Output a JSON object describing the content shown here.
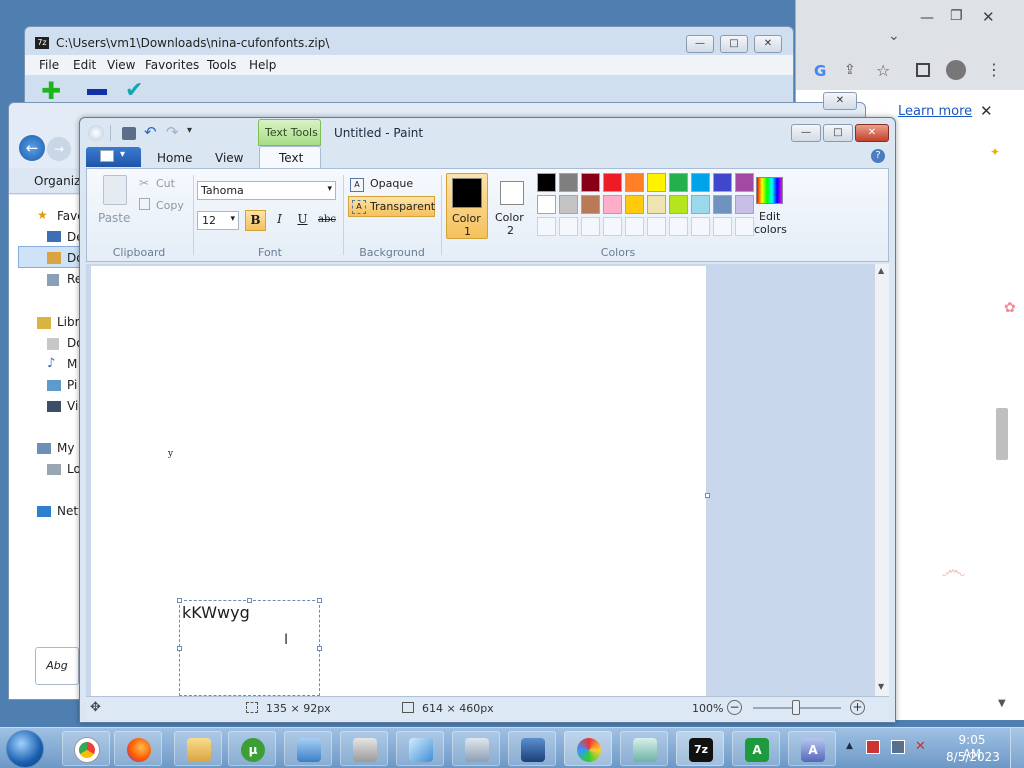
{
  "chrome": {
    "learn_more": "Learn more",
    "close_glyph": "✕"
  },
  "sevenzip": {
    "title": "C:\\Users\\vm1\\Downloads\\nina-cufonfonts.zip\\",
    "menu": [
      "File",
      "Edit",
      "View",
      "Favorites",
      "Tools",
      "Help"
    ]
  },
  "explorer": {
    "organize": "Organize",
    "nav": [
      "Favo",
      "De",
      "Do",
      "Re",
      "Libr",
      "Do",
      "M",
      "Pi",
      "Vi",
      "My",
      "Lo",
      "Netw"
    ],
    "preview_label": "Abg"
  },
  "paint": {
    "title": "Untitled - Paint",
    "context_tab": "Text Tools",
    "tabs": [
      "Home",
      "View",
      "Text"
    ],
    "clipboard": {
      "paste": "Paste",
      "cut": "Cut",
      "copy": "Copy",
      "label": "Clipboard"
    },
    "font": {
      "family": "Tahoma",
      "size": "12",
      "bold": "B",
      "italic": "I",
      "underline": "U",
      "strike": "abc",
      "label": "Font"
    },
    "background": {
      "opaque": "Opaque",
      "transparent": "Transparent",
      "label": "Background"
    },
    "colors": {
      "color1": "Color",
      "color1_num": "1",
      "color2": "Color",
      "color2_num": "2",
      "edit": "Edit",
      "edit2": "colors",
      "label": "Colors",
      "row1": [
        "#000000",
        "#7f7f7f",
        "#880015",
        "#ed1c24",
        "#ff7f27",
        "#fff200",
        "#22b14c",
        "#00a2e8",
        "#3f48cc",
        "#a349a4"
      ],
      "row2": [
        "#ffffff",
        "#c3c3c3",
        "#b97a57",
        "#ffaec9",
        "#ffc90e",
        "#efe4b0",
        "#b5e61d",
        "#99d9ea",
        "#7092be",
        "#c8bfe7"
      ]
    },
    "canvas": {
      "small_char": "y",
      "text_box": "kKWwyg"
    },
    "status": {
      "selection": "135 × 92px",
      "image_size": "614 × 460px",
      "zoom": "100%"
    }
  },
  "taskbar": {
    "time": "9:05 AM",
    "date": "8/5/2023"
  }
}
